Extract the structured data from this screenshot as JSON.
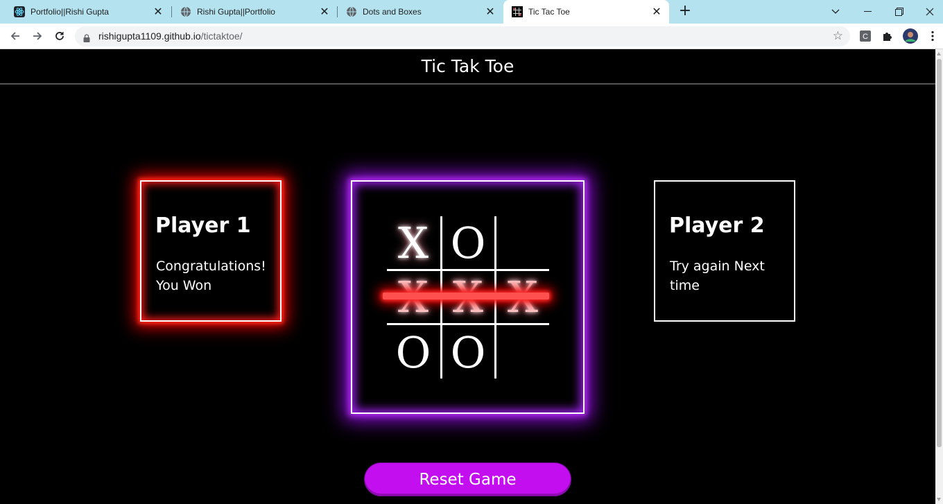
{
  "browser": {
    "tabs": [
      {
        "title": "Portfolio||Rishi Gupta",
        "icon": "react-icon",
        "active": false
      },
      {
        "title": "Rishi Gupta||Portfolio",
        "icon": "globe-icon",
        "active": false
      },
      {
        "title": "Dots and Boxes",
        "icon": "globe-icon",
        "active": false
      },
      {
        "title": "Tic Tac Toe",
        "icon": "tictactoe-icon",
        "active": true
      }
    ],
    "url_host": "rishigupta1109.github.io",
    "url_path": "/tictaktoe/",
    "new_tab_label": "+",
    "close_glyph": "✕"
  },
  "page": {
    "title": "Tic Tak Toe",
    "player1": {
      "name": "Player 1",
      "message_line1": "Congratulations!",
      "message_line2": "You Won"
    },
    "player2": {
      "name": "Player 2",
      "message_line1": "Try again Next",
      "message_line2": "time"
    },
    "board": [
      [
        "X",
        "O",
        ""
      ],
      [
        "X",
        "X",
        "X"
      ],
      [
        "O",
        "O",
        ""
      ]
    ],
    "winning_row": 1,
    "reset_label": "Reset Game"
  },
  "colors": {
    "player1_glow": "#e00000",
    "board_glow": "#8a0fd6",
    "reset_button": "#c30ef0",
    "winning_line": "#ff5050",
    "tab_strip": "#b4e3ef"
  }
}
